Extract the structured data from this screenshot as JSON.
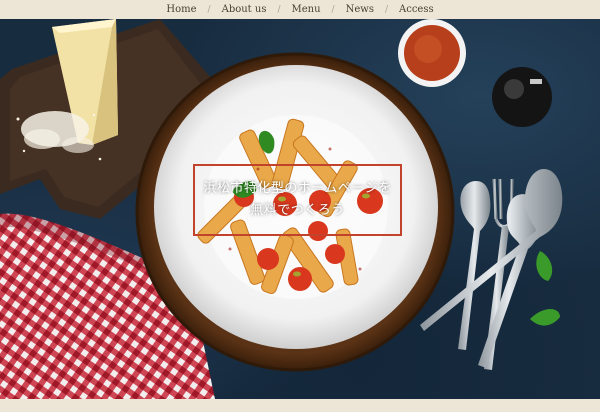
{
  "nav": {
    "items": [
      "Home",
      "About us",
      "Menu",
      "News",
      "Access"
    ],
    "separator": "/"
  },
  "hero": {
    "title_line1": "浜松市特化型のホームページを",
    "title_line2": "無料でつくろう",
    "accent_color": "#c2432b",
    "background_color": "#182c40"
  }
}
